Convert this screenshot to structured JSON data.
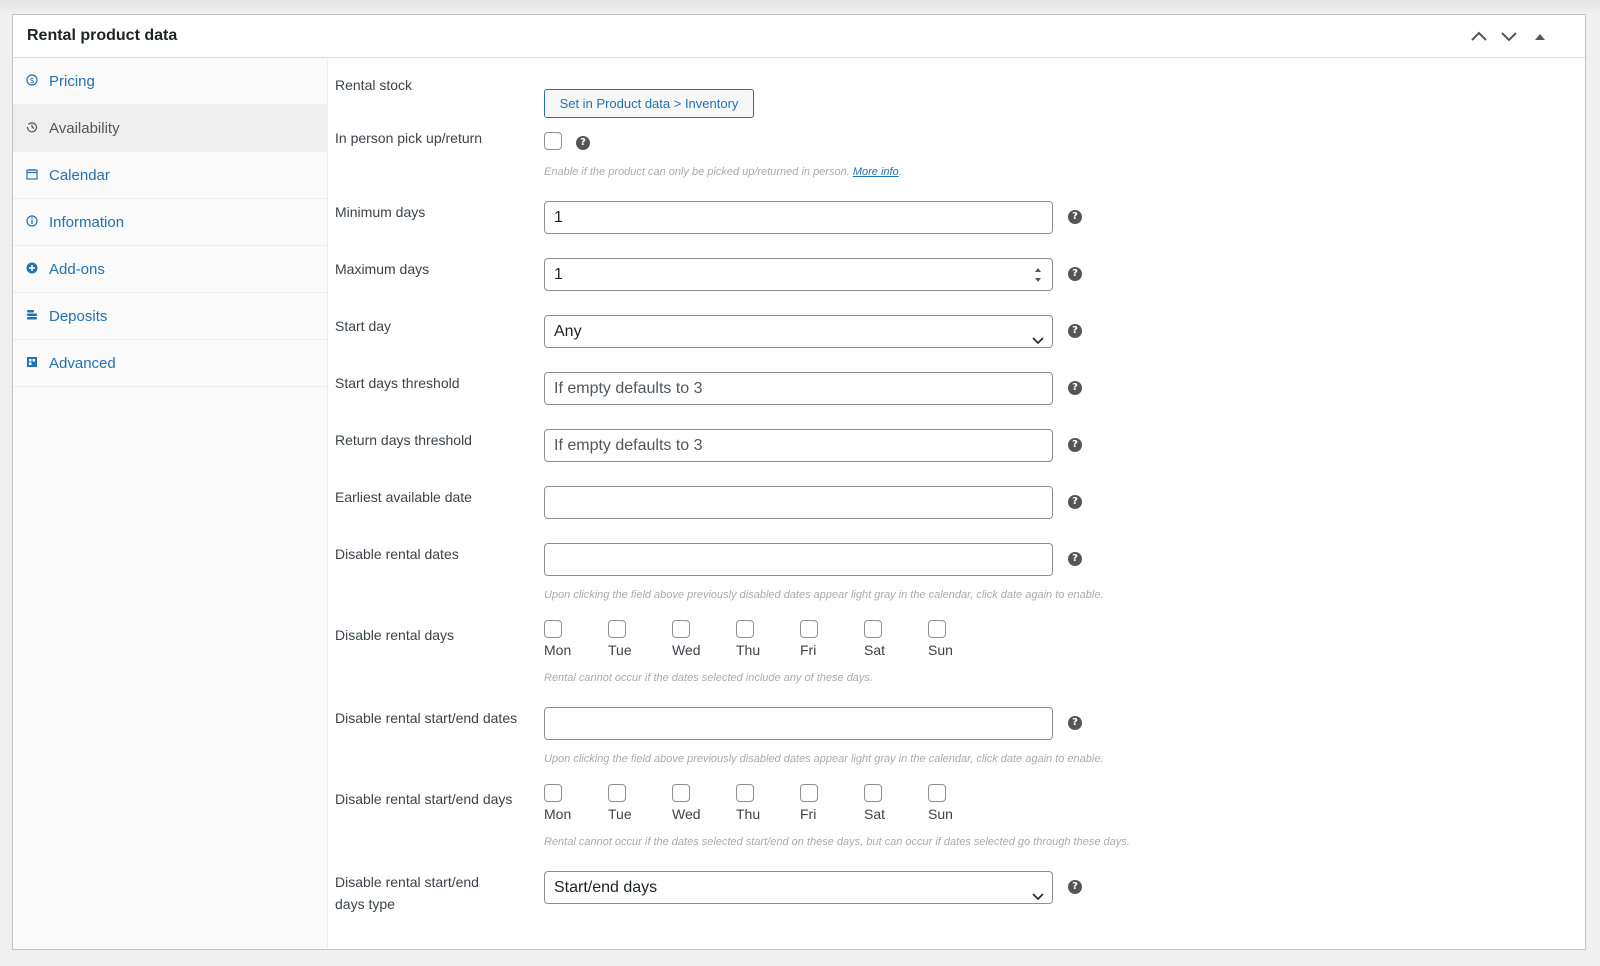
{
  "panel": {
    "title": "Rental product data"
  },
  "tabs": [
    {
      "label": "Pricing",
      "icon": "dollar-circle-icon"
    },
    {
      "label": "Availability",
      "icon": "history-icon"
    },
    {
      "label": "Calendar",
      "icon": "calendar-icon"
    },
    {
      "label": "Information",
      "icon": "info-icon"
    },
    {
      "label": "Add-ons",
      "icon": "plus-circle-icon"
    },
    {
      "label": "Deposits",
      "icon": "coins-icon"
    },
    {
      "label": "Advanced",
      "icon": "grid-icon"
    }
  ],
  "fields": {
    "rental_stock": {
      "label": "Rental stock",
      "button": "Set in Product data > Inventory"
    },
    "pickup": {
      "label": "In person pick up/return",
      "desc": "Enable if the product can only be picked up/returned in person.",
      "link": "More info"
    },
    "min_days": {
      "label": "Minimum days",
      "value": "1"
    },
    "max_days": {
      "label": "Maximum days",
      "value": "1"
    },
    "start_day": {
      "label": "Start day",
      "value": "Any"
    },
    "start_threshold": {
      "label": "Start days threshold",
      "placeholder": "If empty defaults to 3"
    },
    "return_threshold": {
      "label": "Return days threshold",
      "placeholder": "If empty defaults to 3"
    },
    "earliest": {
      "label": "Earliest available date"
    },
    "disable_dates": {
      "label": "Disable rental dates",
      "desc": "Upon clicking the field above previously disabled dates appear light gray in the calendar, click date again to enable."
    },
    "disable_days": {
      "label": "Disable rental days",
      "desc": "Rental cannot occur if the dates selected include any of these days."
    },
    "disable_se_dates": {
      "label": "Disable rental start/end dates",
      "desc": "Upon clicking the field above previously disabled dates appear light gray in the calendar, click date again to enable."
    },
    "disable_se_days": {
      "label": "Disable rental start/end days",
      "desc": "Rental cannot occur if the dates selected start/end on these days, but can occur if dates selected go through these days."
    },
    "disable_se_type": {
      "label_line1": "Disable rental start/end",
      "label_line2": "days type",
      "value": "Start/end days"
    }
  },
  "days": [
    "Mon",
    "Tue",
    "Wed",
    "Thu",
    "Fri",
    "Sat",
    "Sun"
  ],
  "help_glyph": "?",
  "colors": {
    "link": "#2271b1",
    "active_tab_bg": "#eeeeee"
  }
}
